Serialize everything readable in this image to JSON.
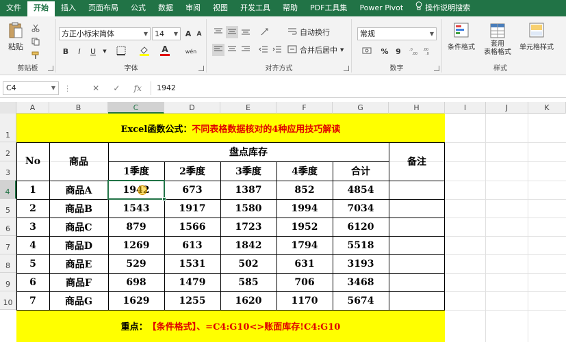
{
  "menu": {
    "items": [
      "文件",
      "开始",
      "插入",
      "页面布局",
      "公式",
      "数据",
      "审阅",
      "视图",
      "开发工具",
      "帮助",
      "PDF工具集",
      "Power Pivot"
    ],
    "active_index": 1,
    "tell_me": "操作说明搜索"
  },
  "ribbon": {
    "clipboard": {
      "label": "剪贴板",
      "paste": "粘贴"
    },
    "font": {
      "label": "字体",
      "font_name": "方正小标宋简体",
      "font_size": "14",
      "bold": "B",
      "italic": "I",
      "underline": "U",
      "grow": "A",
      "shrink": "A",
      "color_letter": "A",
      "wen": "wén"
    },
    "alignment": {
      "label": "对齐方式",
      "wrap": "自动换行",
      "merge": "合并后居中"
    },
    "number": {
      "label": "数字",
      "format": "常规",
      "percent": "%",
      "comma": "9"
    },
    "styles": {
      "label": "样式",
      "cond": "条件格式",
      "table_fmt_1": "套用",
      "table_fmt_2": "表格格式",
      "cell_styles": "单元格样式"
    }
  },
  "formula_bar": {
    "name_box": "C4",
    "cancel": "✕",
    "enter": "✓",
    "fx": "fx",
    "value": "1942"
  },
  "sheet": {
    "columns": [
      "A",
      "B",
      "C",
      "D",
      "E",
      "F",
      "G",
      "H",
      "I",
      "J",
      "K"
    ],
    "rows": [
      "1",
      "2",
      "3",
      "4",
      "5",
      "6",
      "7",
      "8",
      "9",
      "10"
    ],
    "selected_col": "C",
    "selected_row": "4",
    "title": {
      "prefix": "Excel函数公式：",
      "main": "不同表格数据核对的4种应用技巧解读"
    },
    "header": {
      "no": "No",
      "product": "商品",
      "group": "盘点库存",
      "q1": "1季度",
      "q2": "2季度",
      "q3": "3季度",
      "q4": "4季度",
      "total": "合计",
      "note": "备注"
    },
    "data": [
      [
        "1",
        "商品A",
        "1942",
        "673",
        "1387",
        "852",
        "4854"
      ],
      [
        "2",
        "商品B",
        "1543",
        "1917",
        "1580",
        "1994",
        "7034"
      ],
      [
        "3",
        "商品C",
        "879",
        "1566",
        "1723",
        "1952",
        "6120"
      ],
      [
        "4",
        "商品D",
        "1269",
        "613",
        "1842",
        "1794",
        "5518"
      ],
      [
        "5",
        "商品E",
        "529",
        "1531",
        "502",
        "631",
        "3193"
      ],
      [
        "6",
        "商品F",
        "698",
        "1479",
        "585",
        "706",
        "3468"
      ],
      [
        "7",
        "商品G",
        "1629",
        "1255",
        "1620",
        "1170",
        "5674"
      ]
    ],
    "footer": {
      "prefix": "重点：",
      "main": "【条件格式】、=C4:G10<>账面库存!C4:G10"
    }
  },
  "colors": {
    "excel_green": "#217346",
    "highlight": "#ffff00",
    "title_red": "#e00000"
  }
}
